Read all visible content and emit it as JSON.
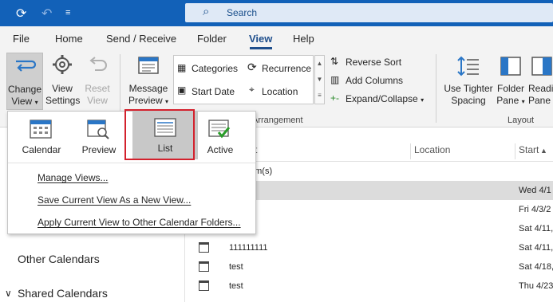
{
  "search": {
    "placeholder": "Search"
  },
  "tabs": [
    {
      "label": "File"
    },
    {
      "label": "Home"
    },
    {
      "label": "Send / Receive"
    },
    {
      "label": "Folder"
    },
    {
      "label": "View",
      "active": true
    },
    {
      "label": "Help"
    }
  ],
  "ribbon": {
    "change_view": {
      "line1": "Change",
      "line2": "View"
    },
    "view_settings": {
      "line1": "View",
      "line2": "Settings"
    },
    "reset_view": {
      "line1": "Reset",
      "line2": "View"
    },
    "message_preview": {
      "line1": "Message",
      "line2": "Preview"
    },
    "arrangement": {
      "categories": "Categories",
      "recurrence": "Recurrence",
      "start_date": "Start Date",
      "location": "Location",
      "group_label": "Arrangement",
      "reverse_sort": "Reverse Sort",
      "add_columns": "Add Columns",
      "expand_collapse": "Expand/Collapse"
    },
    "layout": {
      "use_tighter": {
        "line1": "Use Tighter",
        "line2": "Spacing"
      },
      "folder_pane": {
        "line1": "Folder",
        "line2": "Pane"
      },
      "reading_pane": {
        "line1": "Readi",
        "line2": "Pane"
      },
      "group_label": "Layout"
    }
  },
  "dropdown": {
    "gallery": [
      {
        "label": "Calendar"
      },
      {
        "label": "Preview"
      },
      {
        "label": "List"
      },
      {
        "label": "Active"
      }
    ],
    "menu": [
      {
        "label": "Manage Views..."
      },
      {
        "label": "Save Current View As a New View..."
      },
      {
        "label": "Apply Current View to Other Calendar Folders..."
      }
    ]
  },
  "nav": {
    "other_calendars": "Other Calendars",
    "shared_calendars": "Shared Calendars"
  },
  "list": {
    "columns": {
      "subject": "ct",
      "location": "Location",
      "start": "Start"
    },
    "group_header": "em(s)",
    "rows": [
      {
        "subject": "",
        "start": "Wed 4/1",
        "selected": true
      },
      {
        "subject": "",
        "start": "Fri 4/3/2"
      },
      {
        "subject": "",
        "start": "Sat 4/11,"
      },
      {
        "subject": "111111111",
        "start": "Sat 4/11,"
      },
      {
        "subject": "test",
        "start": "Sat 4/18,"
      },
      {
        "subject": "test",
        "start": "Thu 4/23"
      }
    ]
  },
  "colors": {
    "accent": "#1261b8",
    "highlight": "#d3212d",
    "selected": "#c8c8c8"
  }
}
